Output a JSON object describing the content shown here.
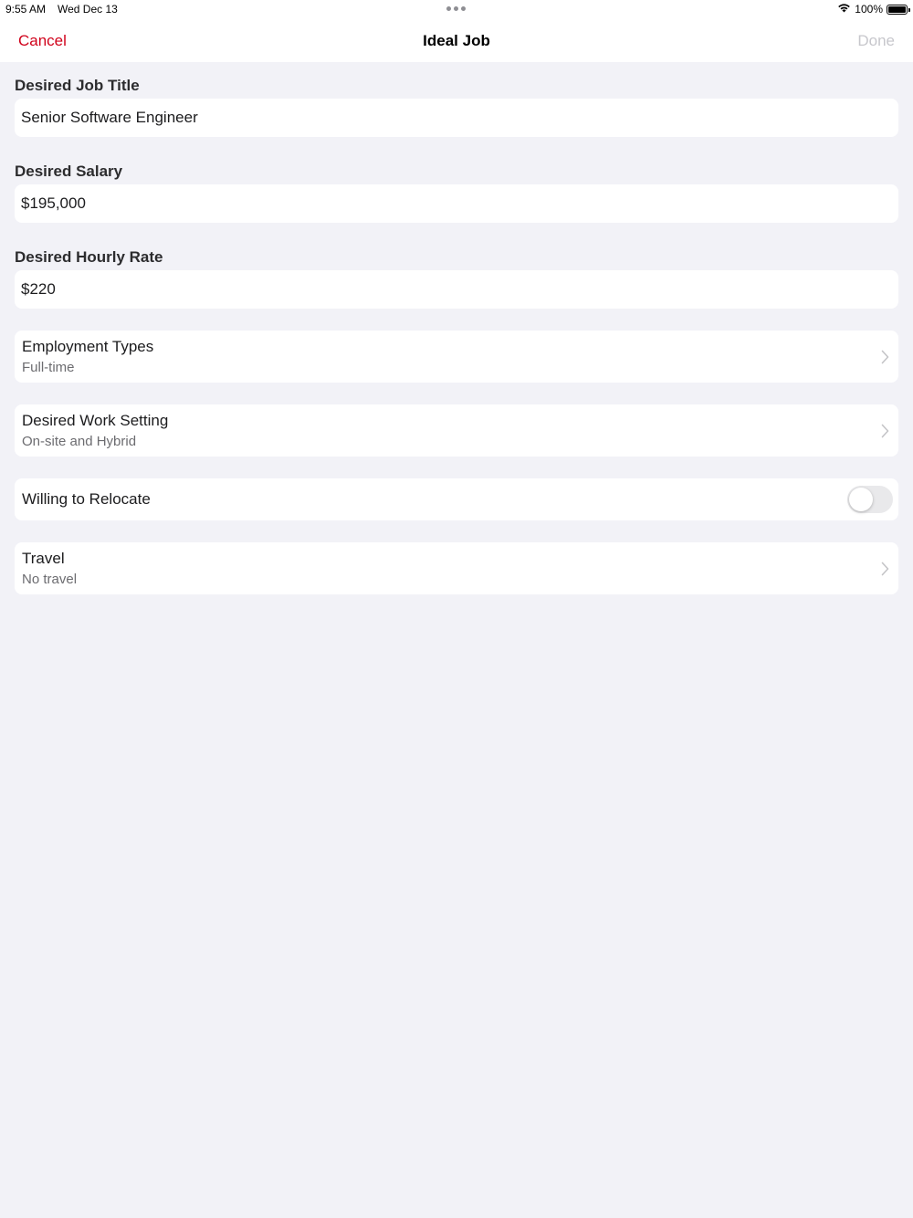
{
  "status_bar": {
    "time": "9:55 AM",
    "date": "Wed Dec 13",
    "battery_percent": "100%",
    "battery_level": 1.0,
    "icons": [
      "wifi-icon",
      "battery-icon",
      "multitasking-dots-icon"
    ]
  },
  "nav": {
    "cancel_label": "Cancel",
    "title": "Ideal Job",
    "done_label": "Done"
  },
  "colors": {
    "accent": "#d0021b",
    "background": "#f2f2f7",
    "cell": "#ffffff",
    "disabled": "#c7c7cc",
    "secondary_text": "#6c6c70"
  },
  "form": {
    "job_title": {
      "label": "Desired Job Title",
      "value": "Senior Software Engineer"
    },
    "salary": {
      "label": "Desired Salary",
      "value": "$195,000"
    },
    "hourly_rate": {
      "label": "Desired Hourly Rate",
      "value": "$220"
    },
    "employment_types": {
      "title": "Employment Types",
      "value": "Full-time"
    },
    "work_setting": {
      "title": "Desired Work Setting",
      "value": "On-site and Hybrid"
    },
    "relocate": {
      "title": "Willing to Relocate",
      "enabled": false
    },
    "travel": {
      "title": "Travel",
      "value": "No travel"
    }
  }
}
